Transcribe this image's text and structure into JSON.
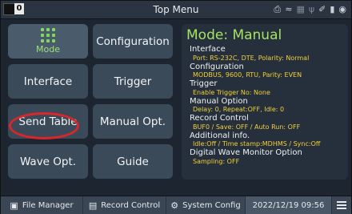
{
  "topbar": {
    "channel_number": "0",
    "title": "Top Menu",
    "status_icons": [
      "printer-icon",
      "wifi-icon",
      "network-icon",
      "usb-icon",
      "pen-icon",
      "card-icon",
      "lock-icon"
    ]
  },
  "menu": {
    "tiles": [
      {
        "id": "mode",
        "label": "Mode",
        "active": true
      },
      {
        "id": "configuration",
        "label": "Configuration"
      },
      {
        "id": "interface",
        "label": "Interface"
      },
      {
        "id": "trigger",
        "label": "Trigger"
      },
      {
        "id": "send_table",
        "label": "Send Table"
      },
      {
        "id": "manual_opt",
        "label": "Manual Opt."
      },
      {
        "id": "wave_opt",
        "label": "Wave Opt."
      },
      {
        "id": "guide",
        "label": "Guide"
      }
    ]
  },
  "info": {
    "heading": "Mode: Manual",
    "sections": [
      {
        "title": "Interface",
        "value": "Port: RS-232C, DTE, Polarity: Normal"
      },
      {
        "title": "Configuration",
        "value": "MODBUS, 9600, RTU, Parity: EVEN"
      },
      {
        "title": "Trigger",
        "value": "Enable Trigger No: None"
      },
      {
        "title": "Manual Option",
        "value": "Delay: 0, Repeat:OFF, Idle: 0"
      },
      {
        "title": "Record Control",
        "value": "BUF0 / Save: OFF / Auto Run: OFF"
      },
      {
        "title": "Additional info.",
        "value": "Idle:Off / Time stamp:MDHMS / Sync:Off"
      },
      {
        "title": "Digital Wave Monitor Option",
        "value": "Sampling: OFF"
      }
    ]
  },
  "bottombar": {
    "file_manager": "File Manager",
    "record_control": "Record Control",
    "system_config": "System Config",
    "datetime": "2022/12/19 09:56"
  },
  "colors": {
    "accent_green": "#a6e263",
    "value_yellow": "#f2cf3a",
    "highlight_red": "#d8262a"
  }
}
